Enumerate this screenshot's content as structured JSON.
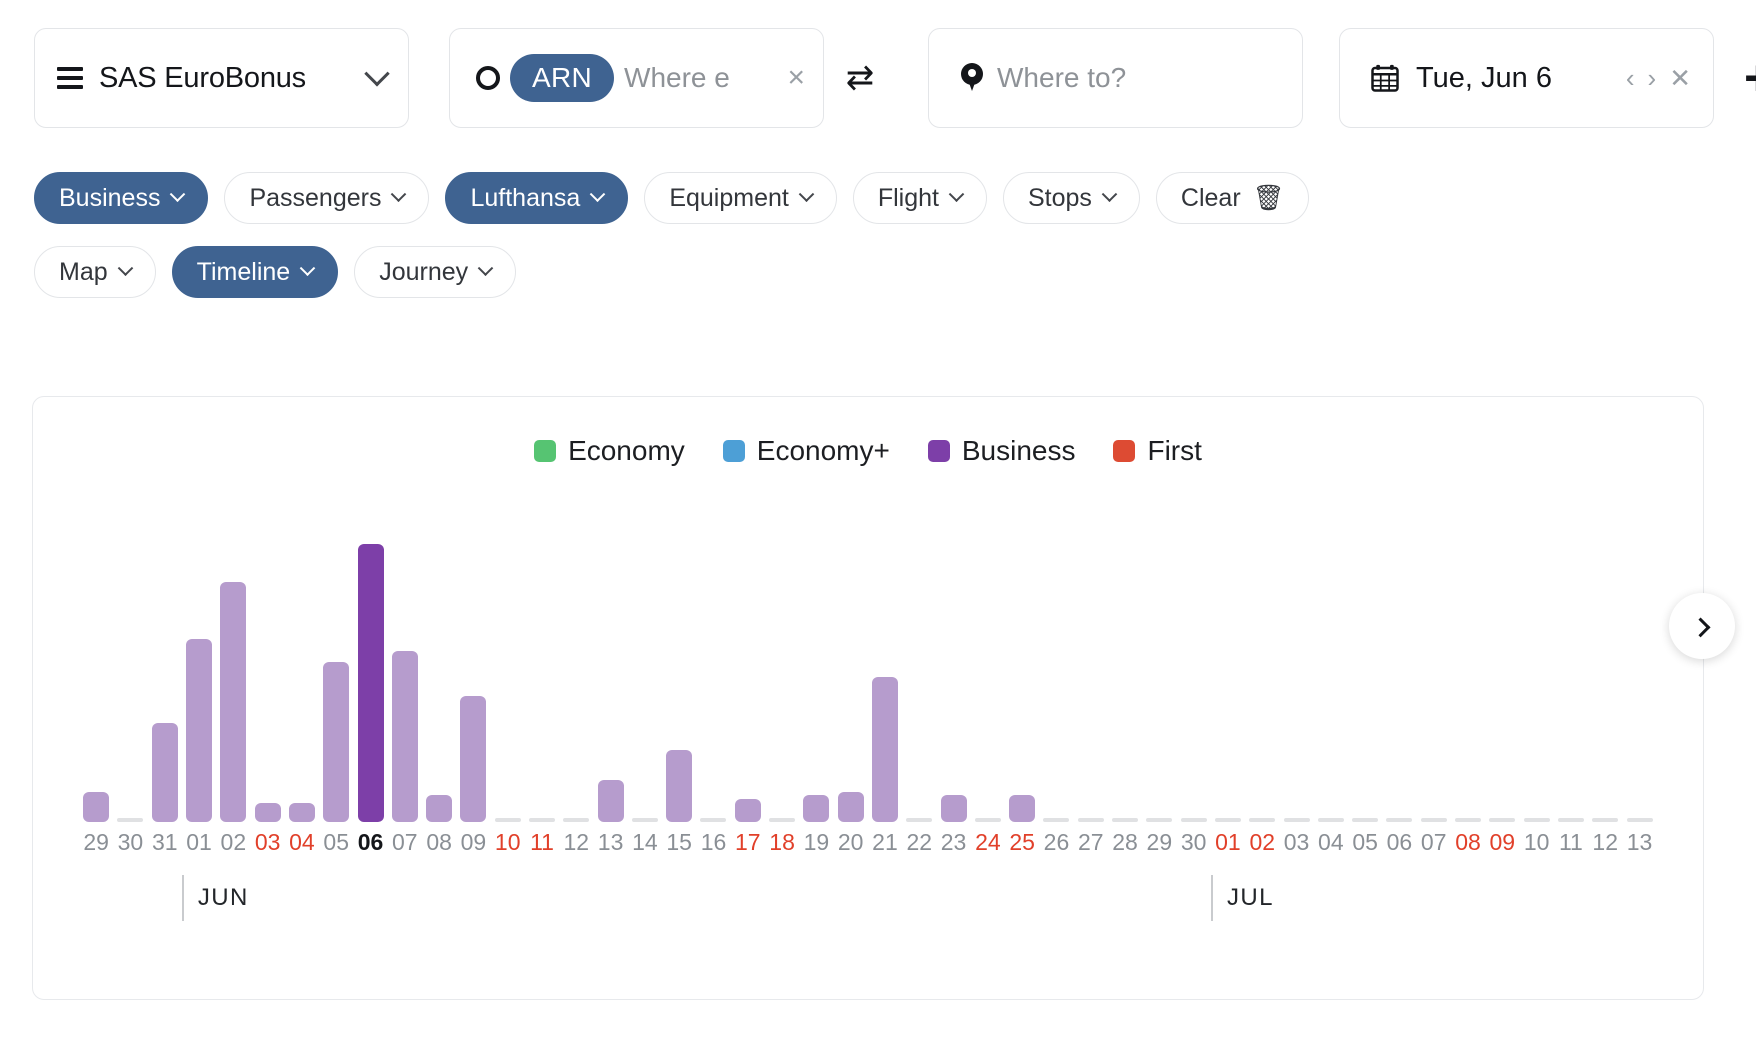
{
  "search": {
    "program": {
      "label": "SAS EuroBonus",
      "menu_icon": "hamburger-icon",
      "chevron": "chevron-down-icon"
    },
    "origin": {
      "trip_type_icon": "circle-icon",
      "code": "ARN",
      "placeholder": "Where e",
      "clear": "×"
    },
    "swap": "⇄",
    "destination": {
      "pin_icon": "location-pin-icon",
      "placeholder": "Where to?"
    },
    "date": {
      "calendar_icon": "calendar-icon",
      "value": "Tue, Jun 6",
      "prev": "‹",
      "next": "›",
      "clear": "✕"
    },
    "add": "+"
  },
  "filters": {
    "row1": [
      {
        "label": "Business",
        "active": true,
        "chevron": true
      },
      {
        "label": "Passengers",
        "active": false,
        "chevron": true
      },
      {
        "label": "Lufthansa",
        "active": true,
        "chevron": true
      },
      {
        "label": "Equipment",
        "active": false,
        "chevron": true
      },
      {
        "label": "Flight",
        "active": false,
        "chevron": true
      },
      {
        "label": "Stops",
        "active": false,
        "chevron": true
      },
      {
        "label": "Clear",
        "active": false,
        "chevron": false,
        "trash": "🗑"
      }
    ],
    "row2": [
      {
        "label": "Map",
        "active": false,
        "chevron": true
      },
      {
        "label": "Timeline",
        "active": true,
        "chevron": true
      },
      {
        "label": "Journey",
        "active": false,
        "chevron": true
      }
    ]
  },
  "accent": "#3f6391",
  "chart_data": {
    "type": "bar",
    "title": "",
    "xlabel": "",
    "ylabel": "",
    "grid": false,
    "legend_position": "top-center",
    "legend": [
      {
        "name": "Economy",
        "color": "#56c472"
      },
      {
        "name": "Economy+",
        "color": "#4d9fd6"
      },
      {
        "name": "Business",
        "color": "#7d3fa8"
      },
      {
        "name": "First",
        "color": "#dd4b33"
      }
    ],
    "selected_category": "06",
    "selected_color": "#7d3fa8",
    "bar_color": "#b69ccd",
    "empty_color": "#e0e1e3",
    "ylim": [
      0,
      100
    ],
    "month_markers": [
      {
        "label": "JUN",
        "index": 3
      },
      {
        "label": "JUL",
        "index": 33
      }
    ],
    "categories": [
      "29",
      "30",
      "31",
      "01",
      "02",
      "03",
      "04",
      "05",
      "06",
      "07",
      "08",
      "09",
      "10",
      "11",
      "12",
      "13",
      "14",
      "15",
      "16",
      "17",
      "18",
      "19",
      "20",
      "21",
      "22",
      "23",
      "24",
      "25",
      "26",
      "27",
      "28",
      "29",
      "30",
      "01",
      "02",
      "03",
      "04",
      "05",
      "06",
      "07",
      "08",
      "09",
      "10",
      "11",
      "12",
      "13"
    ],
    "weekend": [
      "03",
      "04",
      "10",
      "11",
      "17",
      "18",
      "24",
      "25",
      "01",
      "02",
      "08",
      "09"
    ],
    "weekend_index": [
      5,
      6,
      12,
      13,
      19,
      20,
      26,
      27,
      33,
      34,
      40,
      41
    ],
    "values": [
      8,
      0,
      26,
      48,
      63,
      5,
      5,
      42,
      73,
      45,
      7,
      33,
      0,
      0,
      0,
      11,
      0,
      19,
      0,
      6,
      0,
      7,
      8,
      38,
      0,
      7,
      0,
      7,
      0,
      0,
      0,
      0,
      0,
      0,
      0,
      0,
      0,
      0,
      0,
      0,
      0,
      0,
      0,
      0,
      0,
      0
    ],
    "next_button": "next-page-chevron"
  }
}
